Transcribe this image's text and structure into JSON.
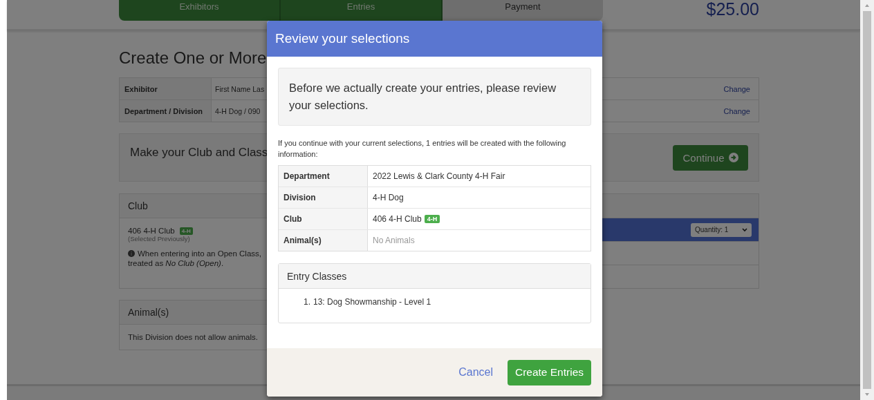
{
  "steps": [
    {
      "label": "Exhibitors",
      "complete": true
    },
    {
      "label": "Entries",
      "complete": true
    },
    {
      "label": "Payment",
      "complete": false
    }
  ],
  "total": "$25.00",
  "page_title": "Create One or More",
  "summary": [
    {
      "label": "Exhibitor",
      "value": "First Name Las",
      "action": "Change"
    },
    {
      "label": "Department / Division",
      "value": "4-H Dog / 090",
      "action": "Change"
    }
  ],
  "prompt": {
    "text": "Make your Club and Class",
    "button": "Continue"
  },
  "club_panel": {
    "title": "Club",
    "club_name": "406 4-H Club",
    "badge": "4-H",
    "note": "(Selected Previously)",
    "info_line_1": "When entering into an Open Class,",
    "info_line_2": "treated as *No Club (Open)*.",
    "class_rows": [
      {
        "selected": true,
        "quantity": "Quantity: 1"
      },
      {
        "selected": false
      },
      {
        "selected": false
      }
    ]
  },
  "animals_panel": {
    "title": "Animal(s)",
    "text": "This Division does not allow animals."
  },
  "modal": {
    "title": "Review your selections",
    "lead": "Before we actually create your entries, please review your selections.",
    "intro": "If you continue with your current selections, 1 entries will be created with the following information:",
    "details": [
      {
        "label": "Department",
        "value": "2022 Lewis & Clark County 4-H Fair",
        "muted": false
      },
      {
        "label": "Division",
        "value": "4-H Dog",
        "muted": false
      },
      {
        "label": "Club",
        "value": "406 4-H Club",
        "badge": "4-H",
        "muted": false
      },
      {
        "label": "Animal(s)",
        "value": "No Animals",
        "muted": true
      }
    ],
    "classes_title": "Entry Classes",
    "classes": [
      {
        "number": "1.",
        "text": "13: Dog Showmanship - Level 1"
      }
    ],
    "cancel": "Cancel",
    "confirm": "Create Entries"
  }
}
